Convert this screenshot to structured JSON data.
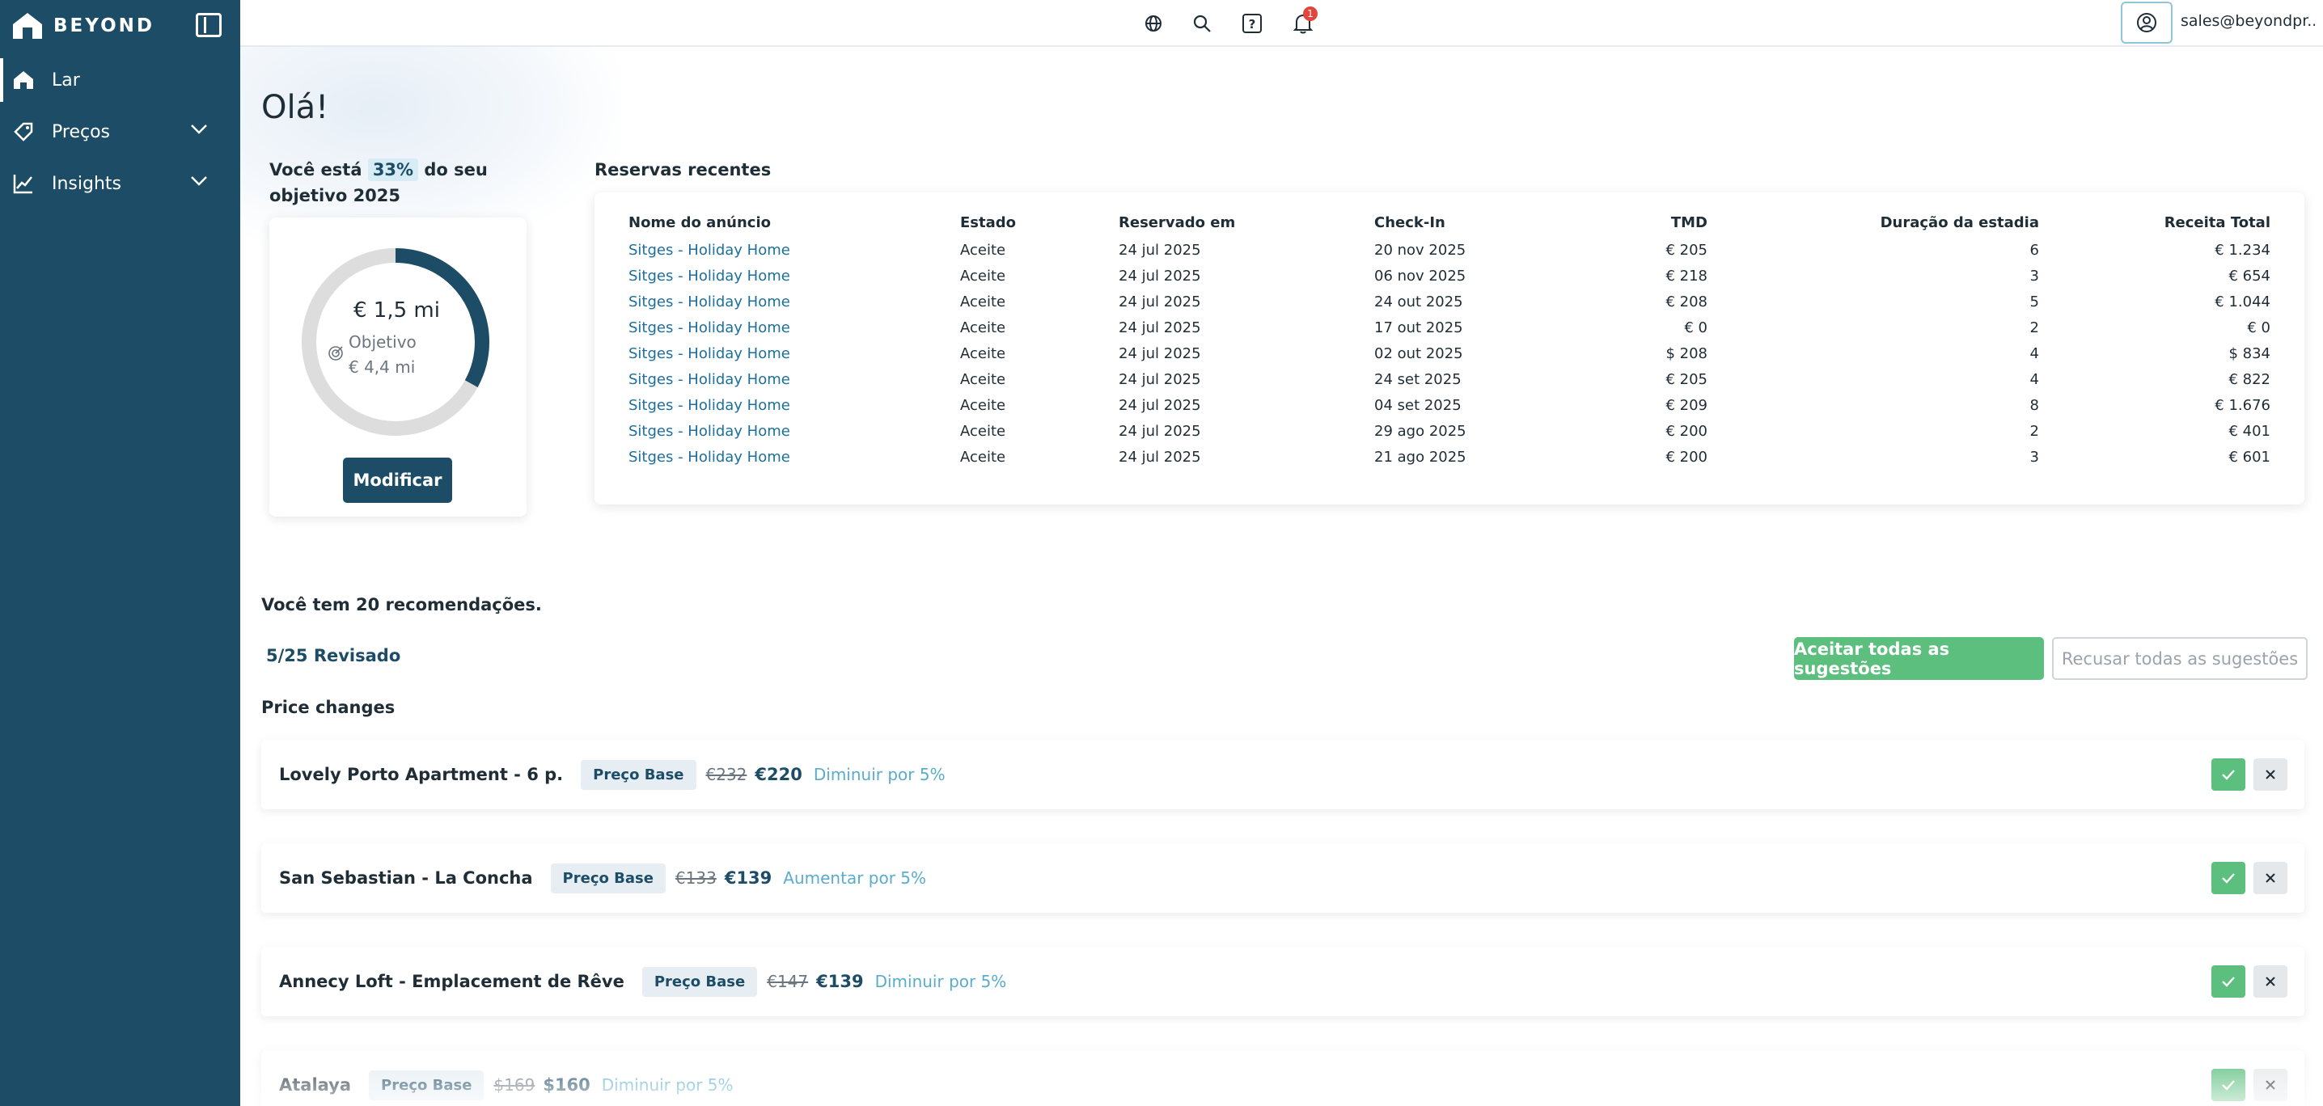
{
  "brand": {
    "name": "BEYOND"
  },
  "sidebar": {
    "items": [
      {
        "label": "Lar",
        "icon": "home-icon",
        "active": true
      },
      {
        "label": "Preços",
        "icon": "price-tag-icon",
        "expandable": true
      },
      {
        "label": "Insights",
        "icon": "chart-line-icon",
        "expandable": true
      }
    ]
  },
  "topbar": {
    "icons": [
      "globe-icon",
      "search-icon",
      "help-icon",
      "bell-icon",
      "user-circle-icon"
    ],
    "notification_count": "1",
    "user_email": "sales@beyondpr..."
  },
  "greeting": "Olá!",
  "goal": {
    "text_before": "Você está",
    "percent": "33%",
    "text_after": "do seu objetivo 2025",
    "progress_fraction": 0.33,
    "amount": "€ 1,5 mi",
    "target_label": "Objetivo",
    "target_amount": "€ 4,4 mi",
    "modify_label": "Modificar",
    "colors": {
      "progress": "#1d4d66",
      "track": "#dddddd"
    }
  },
  "bookings": {
    "title": "Reservas recentes",
    "columns": [
      "Nome do anúncio",
      "Estado",
      "Reservado em",
      "Check-In",
      "TMD",
      "Duração da estadia",
      "Receita Total"
    ],
    "rows": [
      [
        "Sitges - Holiday Home",
        "Aceite",
        "24 jul 2025",
        "20 nov 2025",
        "€ 205",
        "6",
        "€ 1.234"
      ],
      [
        "Sitges - Holiday Home",
        "Aceite",
        "24 jul 2025",
        "06 nov 2025",
        "€ 218",
        "3",
        "€ 654"
      ],
      [
        "Sitges - Holiday Home",
        "Aceite",
        "24 jul 2025",
        "24 out 2025",
        "€ 208",
        "5",
        "€ 1.044"
      ],
      [
        "Sitges - Holiday Home",
        "Aceite",
        "24 jul 2025",
        "17 out 2025",
        "€ 0",
        "2",
        "€ 0"
      ],
      [
        "Sitges - Holiday Home",
        "Aceite",
        "24 jul 2025",
        "02 out 2025",
        "$ 208",
        "4",
        "$ 834"
      ],
      [
        "Sitges - Holiday Home",
        "Aceite",
        "24 jul 2025",
        "24 set 2025",
        "€ 205",
        "4",
        "€ 822"
      ],
      [
        "Sitges - Holiday Home",
        "Aceite",
        "24 jul 2025",
        "04 set 2025",
        "€ 209",
        "8",
        "€ 1.676"
      ],
      [
        "Sitges - Holiday Home",
        "Aceite",
        "24 jul 2025",
        "29 ago 2025",
        "€ 200",
        "2",
        "€ 401"
      ],
      [
        "Sitges - Holiday Home",
        "Aceite",
        "24 jul 2025",
        "21 ago 2025",
        "€ 200",
        "3",
        "€ 601"
      ]
    ]
  },
  "recommendations": {
    "title": "Você tem 20 recomendações.",
    "reviewed": "5/25 Revisado",
    "accept_all": "Aceitar todas as sugestões",
    "decline_all": "Recusar todas as sugestões",
    "section_title": "Price changes",
    "items": [
      {
        "name": "Lovely Porto Apartment - 6 p.",
        "tag": "Preço Base",
        "old_price": "€232",
        "new_price": "€220",
        "action": "Diminuir por 5%"
      },
      {
        "name": "San Sebastian - La Concha",
        "tag": "Preço Base",
        "old_price": "€133",
        "new_price": "€139",
        "action": "Aumentar por 5%"
      },
      {
        "name": "Annecy Loft - Emplacement de Rêve",
        "tag": "Preço Base",
        "old_price": "€147",
        "new_price": "€139",
        "action": "Diminuir por 5%"
      },
      {
        "name": "Atalaya",
        "tag": "Preço Base",
        "old_price": "$169",
        "new_price": "$160",
        "action": "Diminuir por 5%"
      }
    ]
  }
}
